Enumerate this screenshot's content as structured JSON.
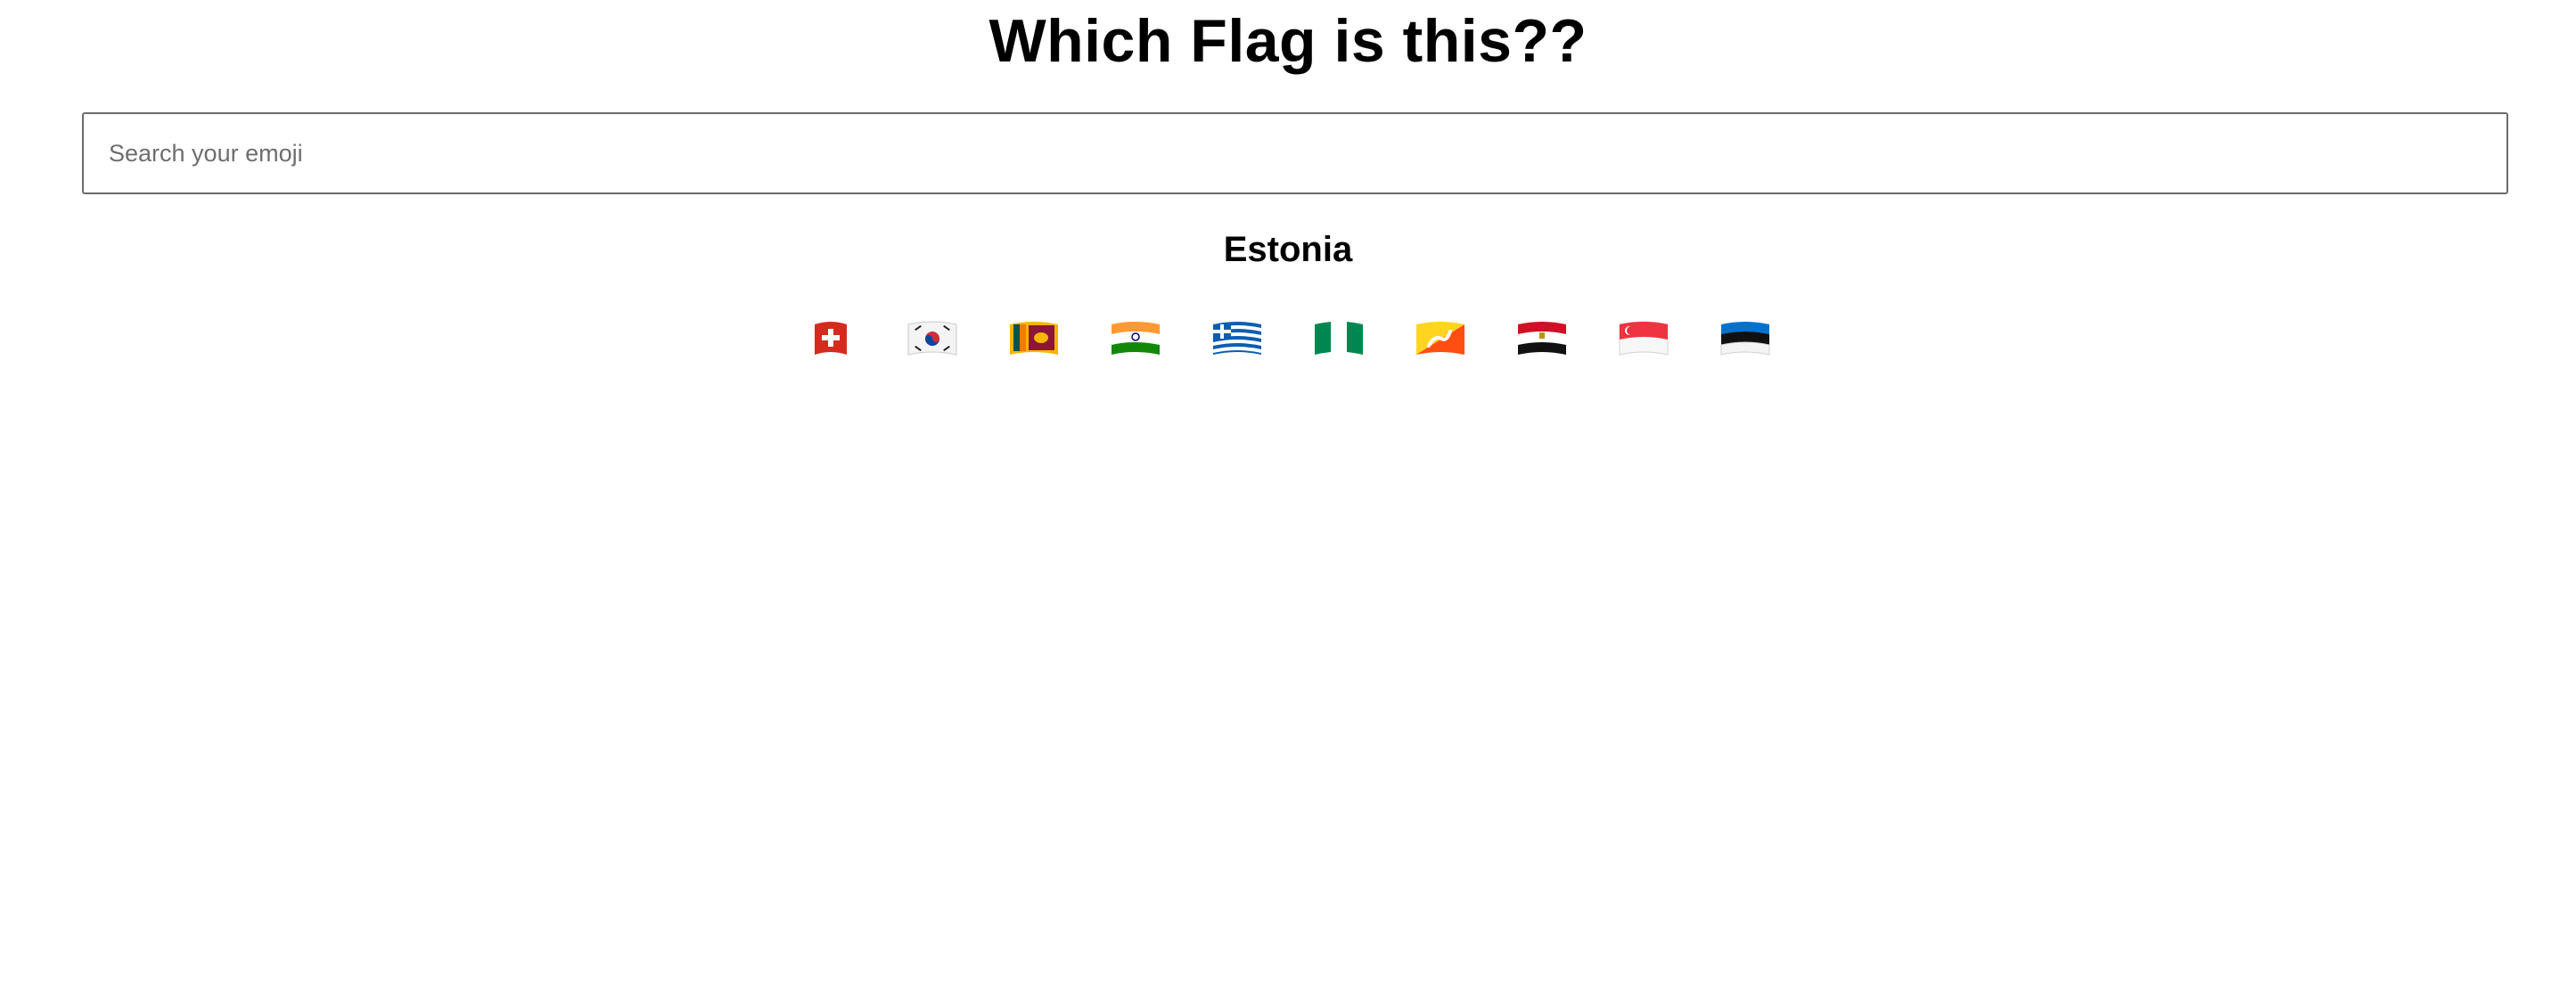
{
  "header": {
    "title": "Which Flag is this??"
  },
  "search": {
    "placeholder": "Search your emoji",
    "value": ""
  },
  "result": {
    "name": "Estonia"
  },
  "flags": [
    {
      "icon": "flag-switzerland-icon",
      "emoji": "🇨🇭"
    },
    {
      "icon": "flag-south-korea-icon",
      "emoji": "🇰🇷"
    },
    {
      "icon": "flag-sri-lanka-icon",
      "emoji": "🇱🇰"
    },
    {
      "icon": "flag-india-icon",
      "emoji": "🇮🇳"
    },
    {
      "icon": "flag-greece-icon",
      "emoji": "🇬🇷"
    },
    {
      "icon": "flag-nigeria-icon",
      "emoji": "🇳🇬"
    },
    {
      "icon": "flag-bhutan-icon",
      "emoji": "🇧🇹"
    },
    {
      "icon": "flag-egypt-icon",
      "emoji": "🇪🇬"
    },
    {
      "icon": "flag-singapore-icon",
      "emoji": "🇸🇬"
    },
    {
      "icon": "flag-estonia-icon",
      "emoji": "🇪🇪"
    }
  ]
}
